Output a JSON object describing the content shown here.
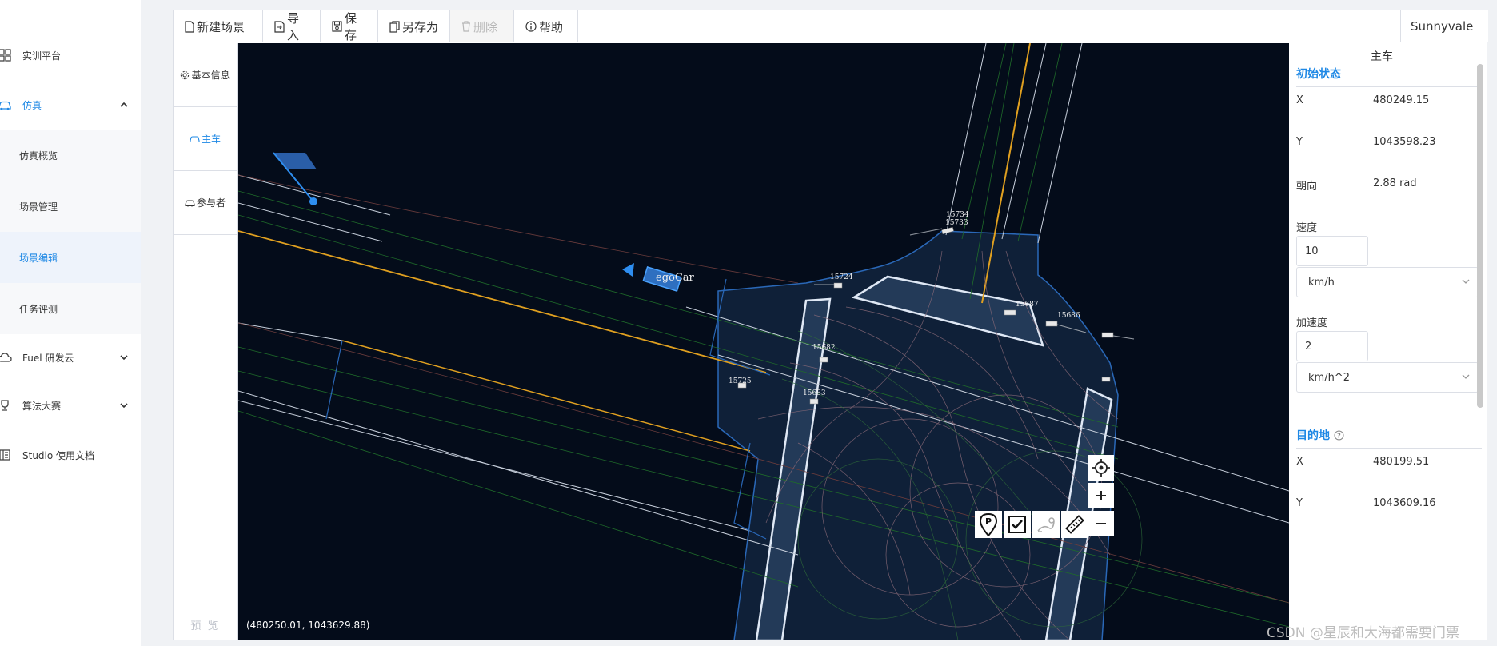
{
  "sidebar": {
    "items": [
      {
        "label": "实训平台",
        "icon": "grid-icon"
      },
      {
        "label": "仿真",
        "icon": "car-icon",
        "expanded": true
      },
      {
        "label": "Fuel 研发云",
        "icon": "cloud-icon"
      },
      {
        "label": "算法大赛",
        "icon": "trophy-icon"
      },
      {
        "label": "Studio 使用文档",
        "icon": "book-icon"
      }
    ],
    "sub_items": [
      {
        "label": "仿真概览"
      },
      {
        "label": "场景管理"
      },
      {
        "label": "场景编辑",
        "active": true
      },
      {
        "label": "任务评测"
      }
    ]
  },
  "toolbar": {
    "new_label": "新建场景",
    "import_label": "导入",
    "save_label": "保存",
    "save_as_label": "另存为",
    "delete_label": "删除",
    "help_label": "帮助",
    "city": "Sunnyvale"
  },
  "tabs": {
    "basic_info": "基本信息",
    "ego_car": "主车",
    "participants": "参与者",
    "preview": "预 览"
  },
  "map": {
    "coordinate_readout": "(480250.01, 1043629.88)",
    "ego_label": "egoCar",
    "obstacle_ids": [
      "15734",
      "15733",
      "15724",
      "15687",
      "15686",
      "15682",
      "15725",
      "15683"
    ],
    "colors": {
      "background": "#040c1a",
      "lane": "#c8d0dc",
      "center_line": "#e0a020",
      "junction": "#1a2c45",
      "ego": "#2e8ef0"
    }
  },
  "panel": {
    "title": "主车",
    "initial_state_title": "初始状态",
    "x_label": "X",
    "x_value": "480249.15",
    "y_label": "Y",
    "y_value": "1043598.23",
    "heading_label": "朝向",
    "heading_value": "2.88 rad",
    "speed_label": "速度",
    "speed_value": "10",
    "speed_unit": "km/h",
    "accel_label": "加速度",
    "accel_value": "2",
    "accel_unit": "km/h^2",
    "destination_title": "目的地",
    "dest_x_label": "X",
    "dest_x_value": "480199.51",
    "dest_y_label": "Y",
    "dest_y_value": "1043609.16"
  },
  "watermark": "CSDN @星辰和大海都需要门票",
  "accent_color": "#1e88e5"
}
